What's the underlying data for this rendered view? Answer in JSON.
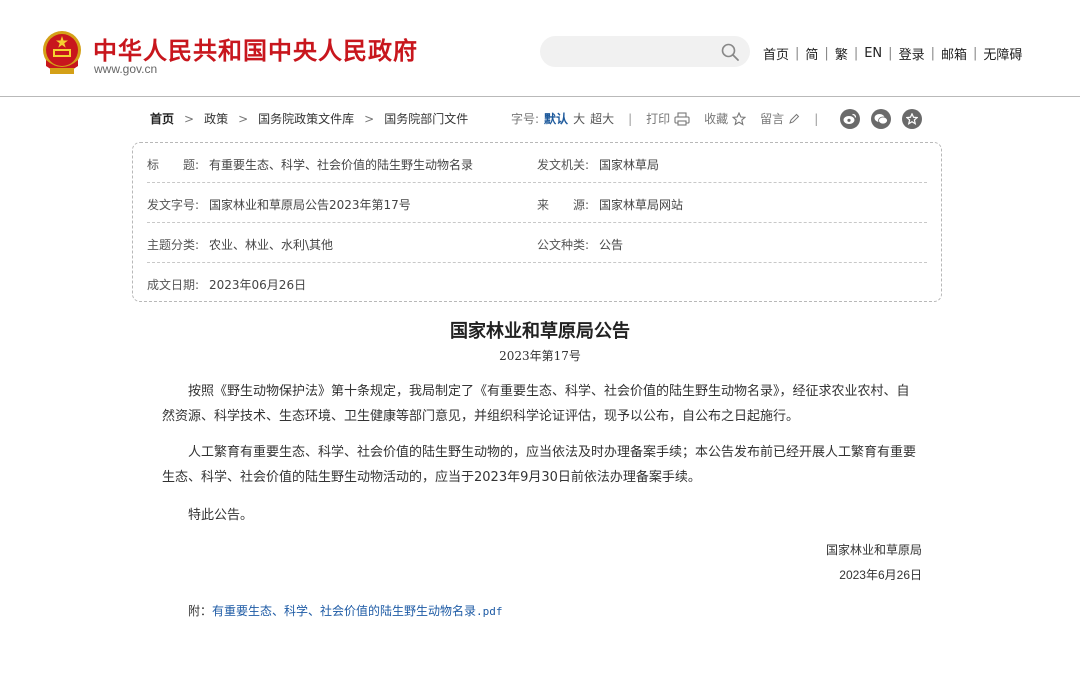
{
  "header": {
    "site_name": "中华人民共和国中央人民政府",
    "domain": "www.gov.cn",
    "search": {
      "placeholder": "",
      "value": ""
    },
    "nav": [
      "首页",
      "简",
      "繁",
      "EN",
      "登录",
      "邮箱",
      "无障碍"
    ],
    "nav_sep": "|"
  },
  "breadcrumb": {
    "items": [
      "首页",
      "政策",
      "国务院政策文件库",
      "国务院部门文件"
    ],
    "arrow": ">"
  },
  "tools": {
    "font_label": "字号:",
    "font_sizes": [
      "默认",
      "大",
      "超大"
    ],
    "divider": "|",
    "print": "打印",
    "favorite": "收藏",
    "comment": "留言"
  },
  "meta": {
    "title_label": "标　　题:",
    "title_value": "有重要生态、科学、社会价值的陆生野生动物名录",
    "issuer_label": "发文机关:",
    "issuer_value": "国家林草局",
    "doc_no_label": "发文字号:",
    "doc_no_value": "国家林业和草原局公告2023年第17号",
    "source_label": "来　　源:",
    "source_value": "国家林草局网站",
    "category_label": "主题分类:",
    "category_value": "农业、林业、水利\\其他",
    "doc_type_label": "公文种类:",
    "doc_type_value": "公告",
    "date_label": "成文日期:",
    "date_value": "2023年06月26日"
  },
  "article": {
    "title": "国家林业和草原局公告",
    "number": "2023年第17号",
    "paragraphs": [
      "按照《野生动物保护法》第十条规定，我局制定了《有重要生态、科学、社会价值的陆生野生动物名录》，经征求农业农村、自然资源、科学技术、生态环境、卫生健康等部门意见，并组织科学论证评估，现予以公布，自公布之日起施行。",
      "人工繁育有重要生态、科学、社会价值的陆生野生动物的，应当依法及时办理备案手续；本公告发布前已经开展人工繁育有重要生态、科学、社会价值的陆生野生动物活动的，应当于2023年9月30日前依法办理备案手续。",
      "特此公告。"
    ],
    "signature_org": "国家林业和草原局",
    "signature_date": "2023年6月26日",
    "attachment_label": "附：",
    "attachment_name": "有重要生态、科学、社会价值的陆生野生动物名录",
    "attachment_ext": ".pdf"
  },
  "colors": {
    "brand_red": "#c8161d",
    "link_blue": "#1e5ba5",
    "active_blue": "#1e5a9c"
  }
}
